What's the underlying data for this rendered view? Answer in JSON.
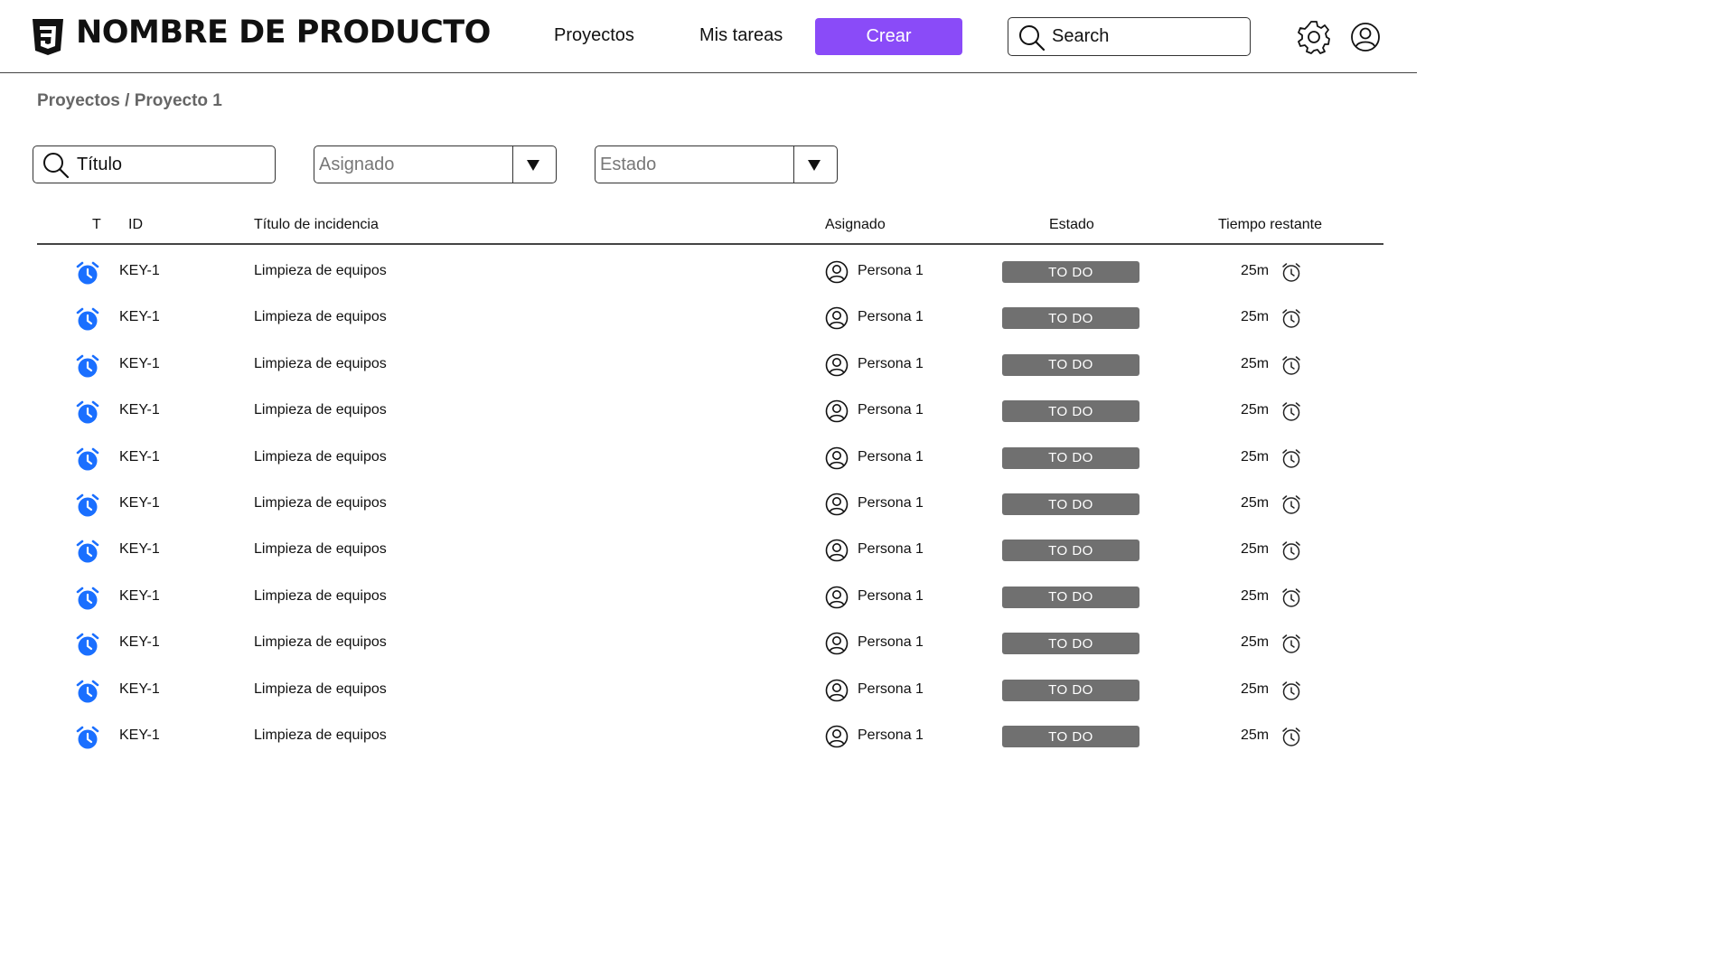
{
  "header": {
    "product_name": "NOMBRE DE PRODUCTO",
    "nav": {
      "projects": "Proyectos",
      "my_tasks": "Mis tareas"
    },
    "create_label": "Crear",
    "search_label": "Search"
  },
  "breadcrumb": "Proyectos / Proyecto 1",
  "filters": {
    "title_value": "Título",
    "assignee_placeholder": "Asignado",
    "status_placeholder": "Estado"
  },
  "table": {
    "headers": {
      "type": "T",
      "id": "ID",
      "title": "Título de incidencia",
      "assignee": "Asignado",
      "status": "Estado",
      "time_left": "Tiempo restante"
    },
    "rows": [
      {
        "id": "KEY-1",
        "title": "Limpieza de equipos",
        "assignee": "Persona 1",
        "status": "TO DO",
        "time_left": "25m"
      },
      {
        "id": "KEY-1",
        "title": "Limpieza de equipos",
        "assignee": "Persona 1",
        "status": "TO DO",
        "time_left": "25m"
      },
      {
        "id": "KEY-1",
        "title": "Limpieza de equipos",
        "assignee": "Persona 1",
        "status": "TO DO",
        "time_left": "25m"
      },
      {
        "id": "KEY-1",
        "title": "Limpieza de equipos",
        "assignee": "Persona 1",
        "status": "TO DO",
        "time_left": "25m"
      },
      {
        "id": "KEY-1",
        "title": "Limpieza de equipos",
        "assignee": "Persona 1",
        "status": "TO DO",
        "time_left": "25m"
      },
      {
        "id": "KEY-1",
        "title": "Limpieza de equipos",
        "assignee": "Persona 1",
        "status": "TO DO",
        "time_left": "25m"
      },
      {
        "id": "KEY-1",
        "title": "Limpieza de equipos",
        "assignee": "Persona 1",
        "status": "TO DO",
        "time_left": "25m"
      },
      {
        "id": "KEY-1",
        "title": "Limpieza de equipos",
        "assignee": "Persona 1",
        "status": "TO DO",
        "time_left": "25m"
      },
      {
        "id": "KEY-1",
        "title": "Limpieza de equipos",
        "assignee": "Persona 1",
        "status": "TO DO",
        "time_left": "25m"
      },
      {
        "id": "KEY-1",
        "title": "Limpieza de equipos",
        "assignee": "Persona 1",
        "status": "TO DO",
        "time_left": "25m"
      },
      {
        "id": "KEY-1",
        "title": "Limpieza de equipos",
        "assignee": "Persona 1",
        "status": "TO DO",
        "time_left": "25m"
      }
    ]
  },
  "icons": {
    "logo": "css3-logo-icon",
    "search": "search-icon",
    "settings": "gear-icon",
    "profile": "user-circle-icon",
    "type": "alarm-clock-icon",
    "assignee": "user-circle-icon",
    "timer": "timer-icon",
    "dropdown": "caret-down-icon"
  },
  "colors": {
    "accent": "#8a4bf8",
    "type_icon": "#1a6fff",
    "status_badge": "#707070"
  }
}
